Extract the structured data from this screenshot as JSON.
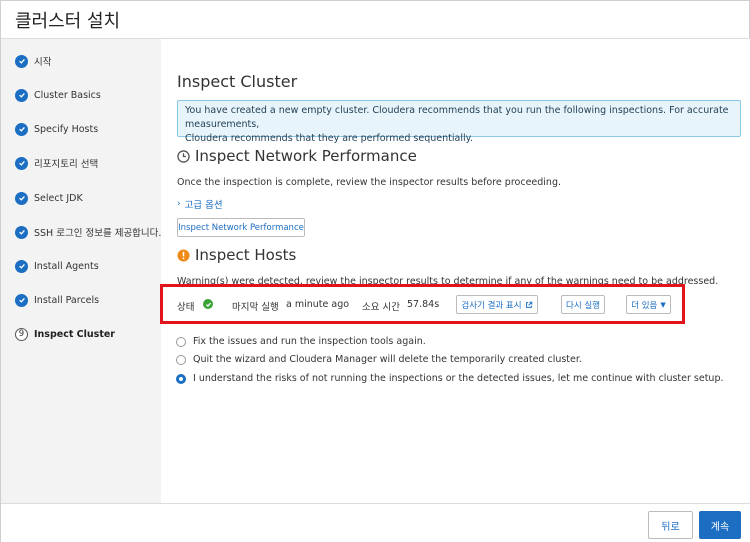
{
  "window": {
    "title": "클러스터 설치"
  },
  "sidebar": {
    "steps": [
      {
        "label": "시작",
        "state": "done"
      },
      {
        "label": "Cluster Basics",
        "state": "done"
      },
      {
        "label": "Specify Hosts",
        "state": "done"
      },
      {
        "label": "리포지토리 선택",
        "state": "done"
      },
      {
        "label": "Select JDK",
        "state": "done"
      },
      {
        "label": "SSH 로그인 정보를 제공합니다.",
        "state": "done"
      },
      {
        "label": "Install Agents",
        "state": "done"
      },
      {
        "label": "Install Parcels",
        "state": "done"
      },
      {
        "label": "Inspect Cluster",
        "state": "current",
        "number": "9"
      }
    ]
  },
  "main": {
    "title": "Inspect Cluster",
    "info_line1": "You have created a new empty cluster. Cloudera recommends that you run the following inspections. For accurate measurements,",
    "info_line2": "Cloudera recommends that they are performed sequentially.",
    "network": {
      "heading": "Inspect Network Performance",
      "description": "Once the inspection is complete, review the inspector results before proceeding.",
      "advanced_link": "고급 옵션",
      "button": "Inspect Network Performance"
    },
    "hosts": {
      "heading": "Inspect Hosts",
      "warning": "Warning(s) were detected, review the inspector results to determine if any of the warnings need to be addressed.",
      "status_label": "상태",
      "last_run_label": "마지막 실행",
      "last_run_value": "a minute ago",
      "duration_label": "소요 시간",
      "duration_value": "57.84s",
      "show_results_button": "검사기 결과 표시",
      "rerun_button": "다시 실행",
      "more_button": "더 있음"
    },
    "options": [
      {
        "label": "Fix the issues and run the inspection tools again.",
        "checked": false
      },
      {
        "label": "Quit the wizard and Cloudera Manager will delete the temporarily created cluster.",
        "checked": false
      },
      {
        "label": "I understand the risks of not running the inspections or the detected issues, let me continue with cluster setup.",
        "checked": true
      }
    ]
  },
  "footer": {
    "back_label": "뒤로",
    "next_label": "계속"
  },
  "colors": {
    "accent": "#1b6ec2",
    "success": "#3aa335",
    "warning": "#f08a16",
    "highlight": "#e0141a"
  }
}
